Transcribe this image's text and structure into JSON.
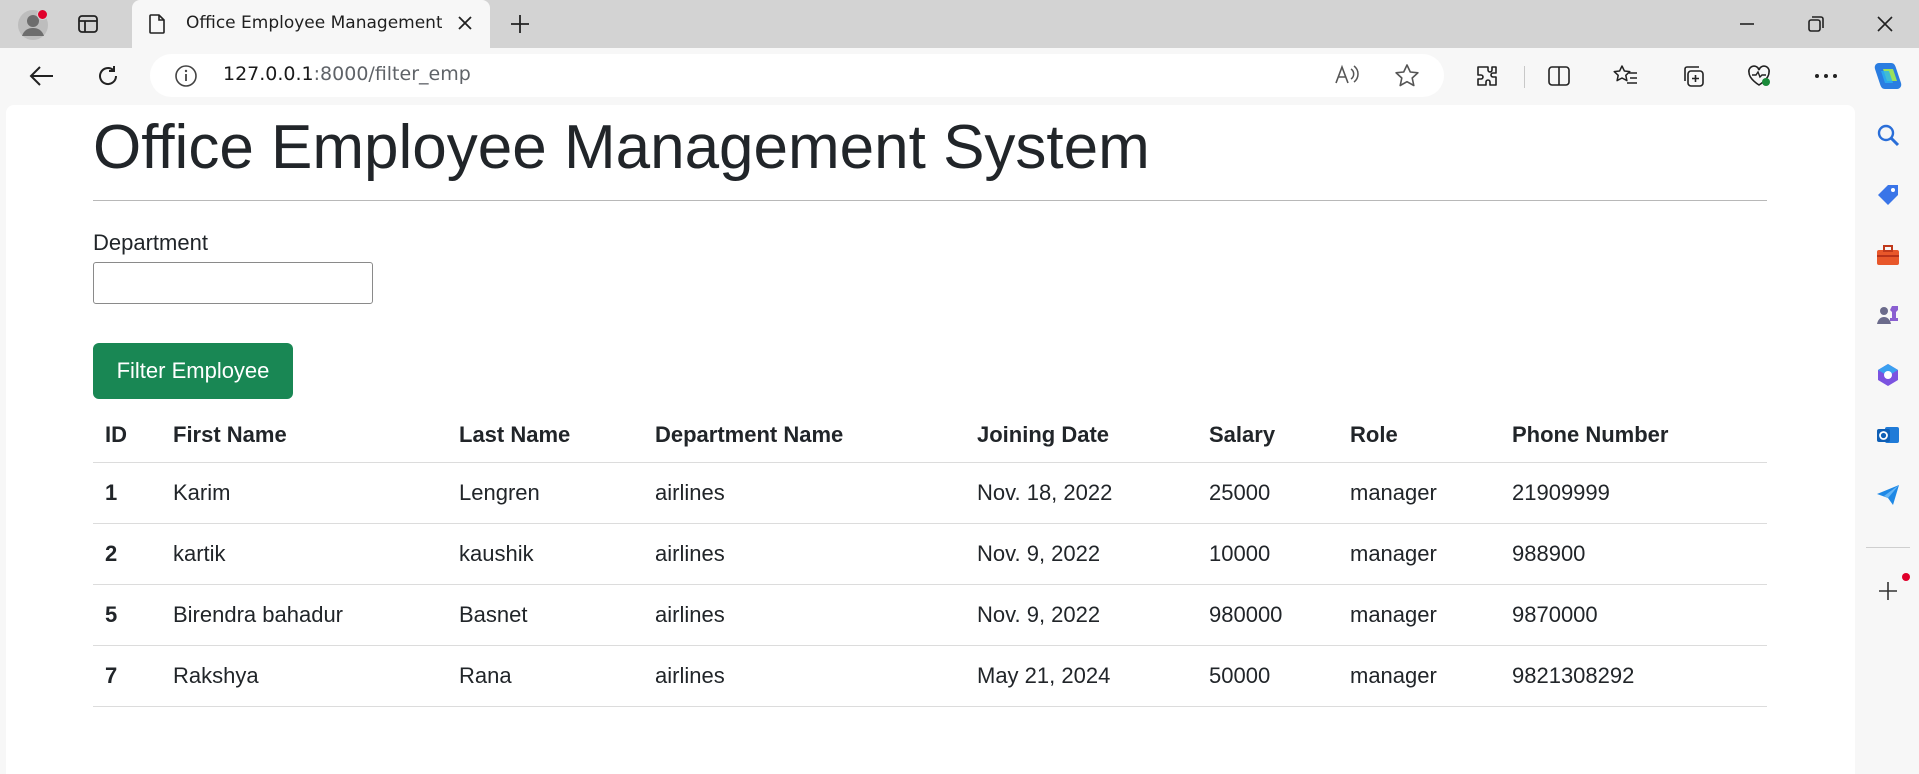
{
  "browser": {
    "tab_title": "Office Employee Management System",
    "url_host": "127.0.0.1",
    "url_rest": ":8000/filter_emp"
  },
  "page": {
    "title": "Office Employee Management System",
    "department_label": "Department",
    "department_value": "",
    "filter_button": "Filter Employee"
  },
  "table": {
    "headers": [
      "ID",
      "First Name",
      "Last Name",
      "Department Name",
      "Joining Date",
      "Salary",
      "Role",
      "Phone Number"
    ],
    "rows": [
      [
        "1",
        "Karim",
        "Lengren",
        "airlines",
        "Nov. 18, 2022",
        "25000",
        "manager",
        "21909999"
      ],
      [
        "2",
        "kartik",
        "kaushik",
        "airlines",
        "Nov. 9, 2022",
        "10000",
        "manager",
        "988900"
      ],
      [
        "5",
        "Birendra bahadur",
        "Basnet",
        "airlines",
        "Nov. 9, 2022",
        "980000",
        "manager",
        "9870000"
      ],
      [
        "7",
        "Rakshya",
        "Rana",
        "airlines",
        "May 21, 2024",
        "50000",
        "manager",
        "9821308292"
      ]
    ]
  },
  "colors": {
    "button_green": "#198754",
    "text": "#212529"
  }
}
